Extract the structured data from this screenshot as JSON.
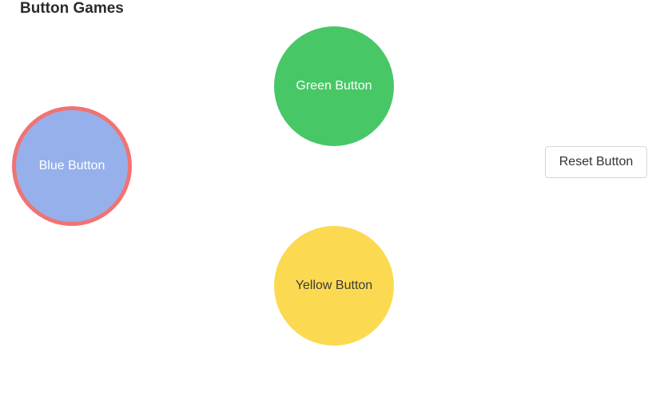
{
  "page": {
    "title": "Button Games"
  },
  "buttons": {
    "green": {
      "label": "Green Button",
      "color": "#48c767"
    },
    "blue": {
      "label": "Blue Button",
      "color": "#96b0ec",
      "highlight_border_color": "#f07373",
      "highlighted": true
    },
    "yellow": {
      "label": "Yellow Button",
      "color": "#fbda52"
    },
    "reset": {
      "label": "Reset Button"
    }
  }
}
